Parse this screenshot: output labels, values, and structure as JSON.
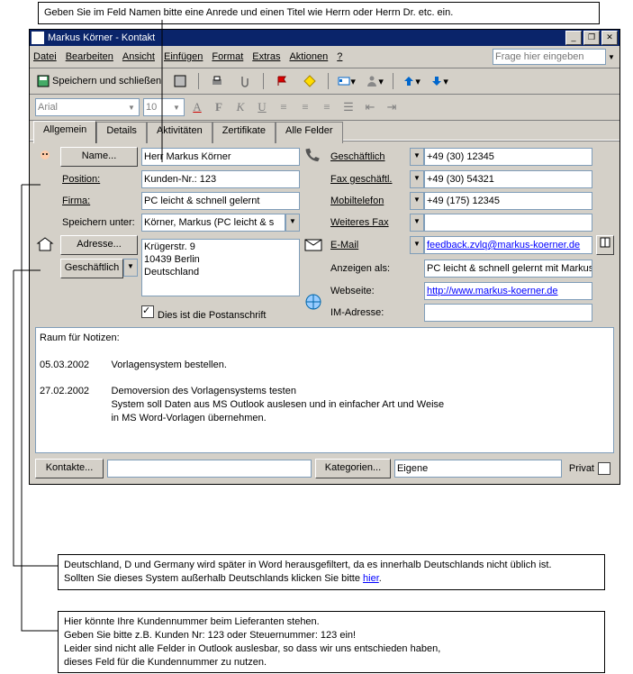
{
  "annotations": {
    "top": "Geben Sie im Feld Namen bitte eine Anrede und einen Titel wie Herrn oder Herrn Dr. etc. ein.",
    "mid1": "Deutschland, D und Germany wird später in Word herausgefiltert, da es innerhalb Deutschlands nicht üblich ist.\nSollten Sie dieses System außerhalb Deutschlands klicken Sie bitte ",
    "mid1_link": "hier",
    "mid1_after": ".",
    "mid2": "Hier könnte Ihre Kundennummer beim Lieferanten stehen.\nGeben Sie bitte z.B. Kunden Nr: 123 oder Steuernummer: 123 ein!\nLeider sind nicht alle Felder in Outlook auslesbar, so dass wir uns entschieden haben,\ndieses Feld für die Kundennummer zu nutzen."
  },
  "window": {
    "title": "Markus Körner - Kontakt"
  },
  "titlebuttons": {
    "min": "_",
    "max": "❐",
    "close": "✕"
  },
  "menu": {
    "items": [
      "Datei",
      "Bearbeiten",
      "Ansicht",
      "Einfügen",
      "Format",
      "Extras",
      "Aktionen",
      "?"
    ],
    "ask_placeholder": "Frage hier eingeben"
  },
  "toolbar": {
    "save": "Speichern und schließen"
  },
  "font": {
    "name": "Arial",
    "size": "10"
  },
  "tabs": [
    "Allgemein",
    "Details",
    "Aktivitäten",
    "Zertifikate",
    "Alle Felder"
  ],
  "labels": {
    "name": "Name...",
    "position": "Position:",
    "firma": "Firma:",
    "speichern": "Speichern unter:",
    "gesch": "Geschäftlich",
    "fax": "Fax geschäftl.",
    "mobil": "Mobiltelefon",
    "wfax": "Weiteres Fax",
    "adresse": "Adresse...",
    "addr_type": "Geschäftlich",
    "postal": "Dies ist die Postanschrift",
    "email": "E-Mail",
    "anzeigen": "Anzeigen als:",
    "web": "Webseite:",
    "im": "IM-Adresse:",
    "kontakte": "Kontakte...",
    "kategorien": "Kategorien...",
    "privat": "Privat"
  },
  "values": {
    "name": "Herr Markus Körner",
    "position": "Kunden-Nr.: 123",
    "firma": "PC leicht & schnell gelernt",
    "speichern": "Körner, Markus (PC leicht & s",
    "gesch": "+49 (30) 12345",
    "fax": "+49 (30) 54321",
    "mobil": "+49 (175) 12345",
    "wfax": "",
    "address": "Krügerstr. 9\n10439 Berlin\nDeutschland",
    "email": "feedback.zvlq@markus-koerner.de",
    "anzeigen": "PC leicht & schnell gelernt mit Markus Körner",
    "web": "http://www.markus-koerner.de",
    "im": "",
    "kategorien": "Eigene",
    "notes": "Raum für Notizen:\n\n05.03.2002        Vorlagensystem bestellen.\n\n27.02.2002        Demoversion des Vorlagensystems testen\n                          System soll Daten aus MS Outlook auslesen und in einfacher Art und Weise\n                          in MS Word-Vorlagen übernehmen."
  }
}
